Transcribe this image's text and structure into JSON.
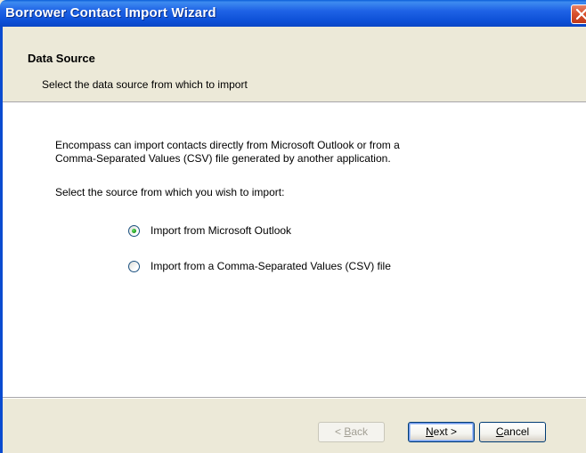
{
  "window": {
    "title": "Borrower Contact Import Wizard"
  },
  "header": {
    "title": "Data Source",
    "subtitle": "Select the data source from which to import"
  },
  "content": {
    "intro_line1": "Encompass can import contacts directly from Microsoft Outlook or from a",
    "intro_line2": "Comma-Separated Values (CSV) file generated by another application.",
    "prompt": "Select the source from which you wish to import:",
    "options": [
      {
        "label": "Import from Microsoft Outlook",
        "selected": true
      },
      {
        "label": "Import from a Comma-Separated Values (CSV) file",
        "selected": false
      }
    ]
  },
  "footer": {
    "back": {
      "prefix": "< ",
      "mnemonic": "B",
      "rest": "ack",
      "enabled": false
    },
    "next": {
      "mnemonic": "N",
      "rest": "ext >",
      "enabled": true
    },
    "cancel": {
      "mnemonic": "C",
      "rest": "ancel",
      "enabled": true
    }
  },
  "colors": {
    "titlebar": "#0C4FD6",
    "dialog_bg": "#ECE9D8",
    "close_button": "#D9532E",
    "radio_dot": "#21A121"
  },
  "icons": {
    "close": "close-icon",
    "radio_selected": "radio-selected-icon",
    "radio_unselected": "radio-unselected-icon"
  }
}
